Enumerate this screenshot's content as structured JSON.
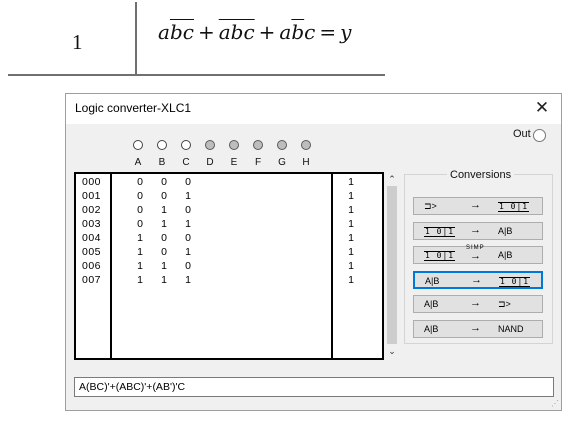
{
  "formula_table": {
    "row_number": "1",
    "equation_terms": [
      {
        "plain": "a",
        "over": "bc"
      },
      {
        "over": "abc"
      },
      {
        "plain": "a",
        "over": "b",
        "tail": "c"
      }
    ],
    "equation_plus": "+",
    "equation_eq": "=",
    "equation_rhs": "y"
  },
  "window": {
    "title": "Logic converter-XLC1",
    "close_glyph": "✕",
    "out_label": "Out"
  },
  "terminals": [
    {
      "label": "A",
      "state": "on"
    },
    {
      "label": "B",
      "state": "on"
    },
    {
      "label": "C",
      "state": "on"
    },
    {
      "label": "D",
      "state": "off"
    },
    {
      "label": "E",
      "state": "off"
    },
    {
      "label": "F",
      "state": "off"
    },
    {
      "label": "G",
      "state": "off"
    },
    {
      "label": "H",
      "state": "off"
    }
  ],
  "truth_table": {
    "rows": [
      {
        "index": "000",
        "bits": [
          "0",
          "0",
          "0"
        ],
        "out": "1"
      },
      {
        "index": "001",
        "bits": [
          "0",
          "0",
          "1"
        ],
        "out": "1"
      },
      {
        "index": "002",
        "bits": [
          "0",
          "1",
          "0"
        ],
        "out": "1"
      },
      {
        "index": "003",
        "bits": [
          "0",
          "1",
          "1"
        ],
        "out": "1"
      },
      {
        "index": "004",
        "bits": [
          "1",
          "0",
          "0"
        ],
        "out": "1"
      },
      {
        "index": "005",
        "bits": [
          "1",
          "0",
          "1"
        ],
        "out": "1"
      },
      {
        "index": "006",
        "bits": [
          "1",
          "1",
          "0"
        ],
        "out": "1"
      },
      {
        "index": "007",
        "bits": [
          "1",
          "1",
          "1"
        ],
        "out": "1"
      }
    ]
  },
  "scrollbar": {
    "up_glyph": "⌃",
    "down_glyph": "⌄"
  },
  "conversions": {
    "legend": "Conversions",
    "arrow_glyph": "→",
    "gate_glyph": "⊐>",
    "truth_glyph": "1 0|1",
    "simp_label": "SIMP",
    "ab_label": "A|B",
    "nand_label": "NAND",
    "buttons": [
      {
        "from": "gate",
        "to": "truth"
      },
      {
        "from": "truth",
        "to": "ab"
      },
      {
        "from": "truth",
        "to": "ab",
        "simp": true
      },
      {
        "from": "ab",
        "to": "truth",
        "selected": true
      },
      {
        "from": "ab",
        "to": "gate"
      },
      {
        "from": "ab",
        "to": "nand"
      }
    ]
  },
  "expression": "A(BC)'+(ABC)'+(AB')'C",
  "grip_glyph": "⋰"
}
